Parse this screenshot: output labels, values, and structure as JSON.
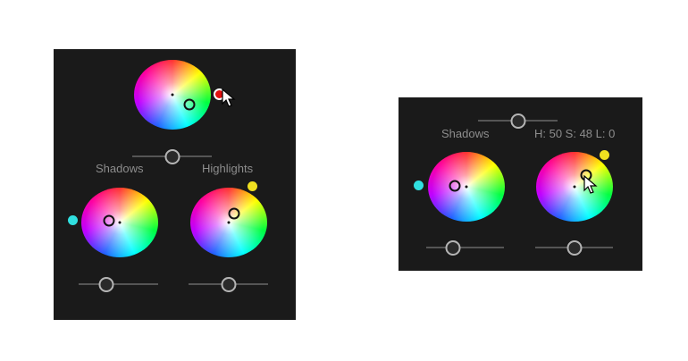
{
  "left_panel": {
    "shadows_label": "Shadows",
    "highlights_label": "Highlights",
    "wheels": [
      {
        "name": "global",
        "swatch_color": "#e01010"
      },
      {
        "name": "shadows",
        "swatch_color": "#30e0e0"
      },
      {
        "name": "highlights",
        "swatch_color": "#f0e020"
      }
    ],
    "sliders": [
      {
        "name": "blending",
        "value": 0.5
      },
      {
        "name": "shadows-luminance",
        "value": 0.35
      },
      {
        "name": "highlights-luminance",
        "value": 0.5
      }
    ]
  },
  "right_panel": {
    "shadows_label": "Shadows",
    "hsl_readout": "H: 50 S: 48 L: 0",
    "wheels": [
      {
        "name": "shadows",
        "swatch_color": "#30e0e0"
      },
      {
        "name": "highlights",
        "swatch_color": "#f0e020"
      }
    ],
    "sliders": [
      {
        "name": "blending",
        "value": 0.5
      },
      {
        "name": "shadows-luminance",
        "value": 0.35
      },
      {
        "name": "highlights-luminance",
        "value": 0.5
      }
    ]
  },
  "colors": {
    "panel_background": "#1a1a1a",
    "label_text": "#8d8d8d",
    "page_background": "#ffffff"
  }
}
